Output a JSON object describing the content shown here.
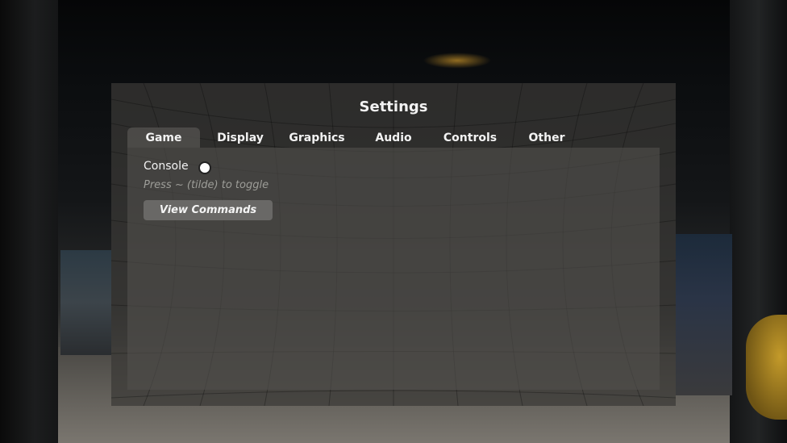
{
  "settings": {
    "title": "Settings",
    "tabs": [
      {
        "label": "Game",
        "active": true
      },
      {
        "label": "Display",
        "active": false
      },
      {
        "label": "Graphics",
        "active": false
      },
      {
        "label": "Audio",
        "active": false
      },
      {
        "label": "Controls",
        "active": false
      },
      {
        "label": "Other",
        "active": false
      }
    ],
    "game": {
      "console_label": "Console",
      "console_enabled": true,
      "console_hint": "Press ~ (tilde) to toggle",
      "view_commands_label": "View Commands"
    }
  },
  "colors": {
    "panel_bg": "#3a3936",
    "text": "#f2f2f2",
    "hint_text": "#9d9d98",
    "button_bg": "#6e6d6a",
    "toggle_knob": "#ffffff"
  },
  "icons": {
    "console_toggle": "toggle-dot-icon"
  }
}
